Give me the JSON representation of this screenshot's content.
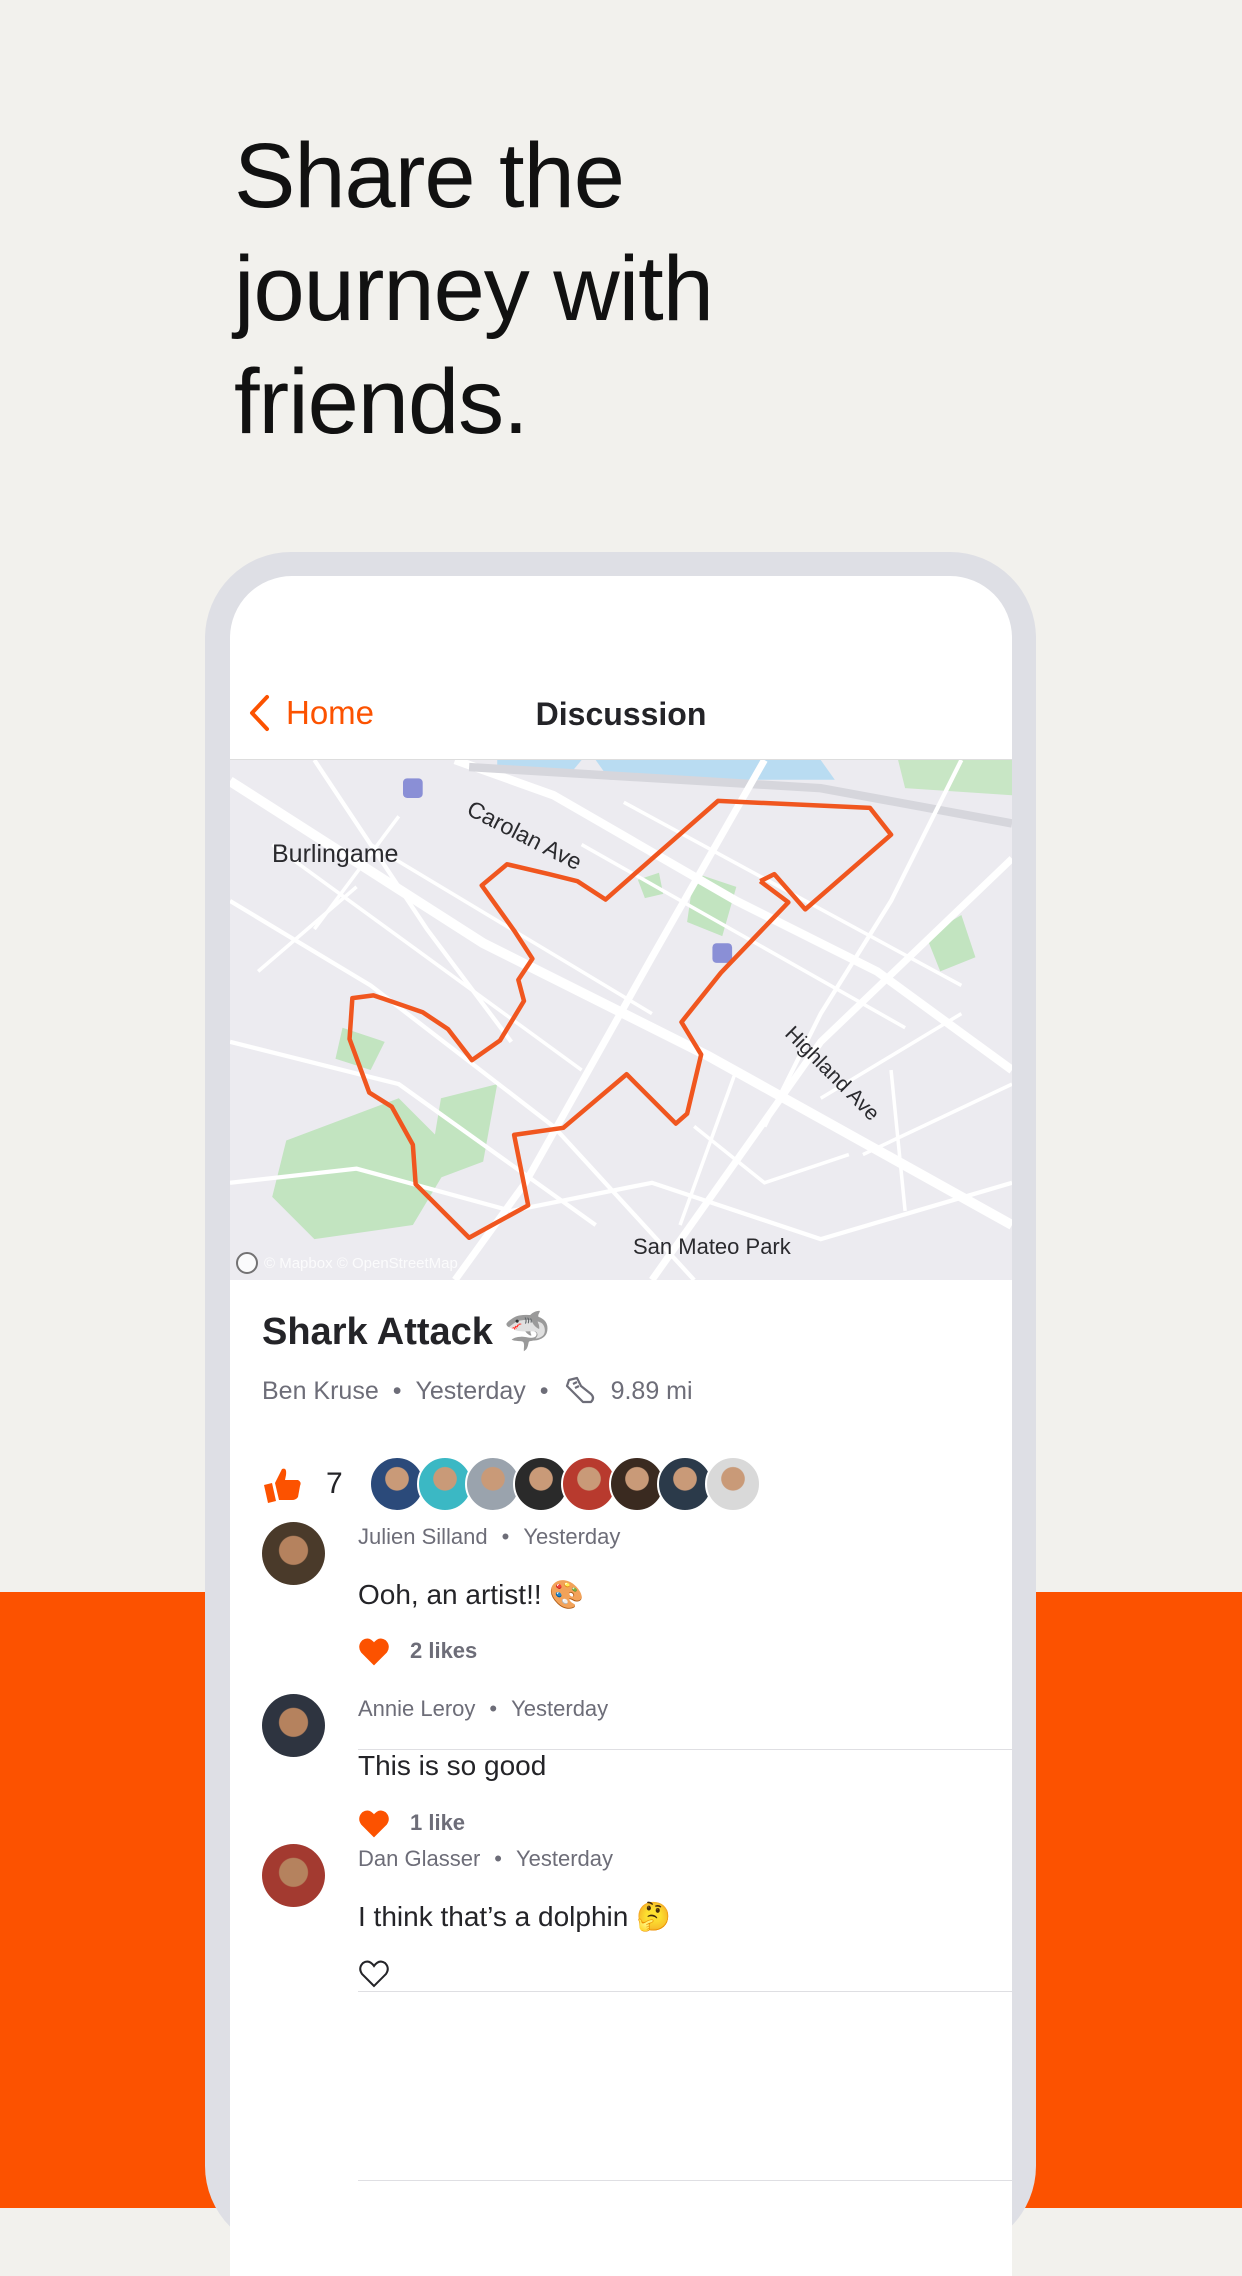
{
  "headline": [
    "Share the",
    "journey with",
    "friends."
  ],
  "colors": {
    "brand": "#fc5200",
    "background": "#f2f1ed",
    "route": "#f0561f"
  },
  "nav": {
    "back_label": "Home",
    "title": "Discussion",
    "back_icon": "chevron-left-icon"
  },
  "map": {
    "labels": {
      "city": "Burlingame",
      "street1": "Carolan Ave",
      "street2": "Highland Ave",
      "park": "San Mateo Park"
    },
    "attribution": "© Mapbox © OpenStreetMap"
  },
  "activity": {
    "title": "Shark Attack 🦈",
    "athlete": "Ben Kruse",
    "date": "Yesterday",
    "sport_icon": "running-shoe-icon",
    "distance": "9.89 mi",
    "kudos_count": "7",
    "kudos_avatar_colors": [
      "#2b4a7a",
      "#3bb8c4",
      "#9aa3ad",
      "#2a2a2a",
      "#b83a2e",
      "#3a2a20",
      "#2b3a4a",
      "#d9d9d9"
    ]
  },
  "comments": [
    {
      "author": "Julien Silland",
      "time": "Yesterday",
      "text": "Ooh, an artist!! 🎨",
      "likes": "2 likes",
      "liked": true,
      "avatar_color": "#4a3a2a"
    },
    {
      "author": "Annie Leroy",
      "time": "Yesterday",
      "text": "This is so good",
      "likes": "1 like",
      "liked": true,
      "avatar_color": "#2e3440"
    },
    {
      "author": "Dan Glasser",
      "time": "Yesterday",
      "text": "I think that’s a dolphin 🤔",
      "likes": "",
      "liked": false,
      "avatar_color": "#a33a30"
    }
  ]
}
